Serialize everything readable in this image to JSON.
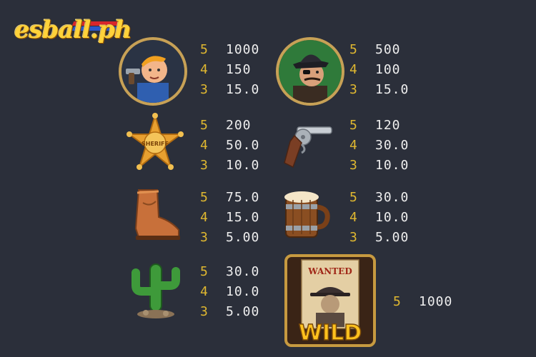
{
  "logo": {
    "text": "esball.ph"
  },
  "symbols": [
    {
      "name": "cowboy",
      "pays": [
        [
          "5",
          "1000"
        ],
        [
          "4",
          "150"
        ],
        [
          "3",
          "15.0"
        ]
      ]
    },
    {
      "name": "bandit",
      "pays": [
        [
          "5",
          "500"
        ],
        [
          "4",
          "100"
        ],
        [
          "3",
          "15.0"
        ]
      ]
    },
    {
      "name": "sheriff-badge",
      "label": "SHERIFF",
      "pays": [
        [
          "5",
          "200"
        ],
        [
          "4",
          "50.0"
        ],
        [
          "3",
          "10.0"
        ]
      ]
    },
    {
      "name": "revolver",
      "pays": [
        [
          "5",
          "120"
        ],
        [
          "4",
          "30.0"
        ],
        [
          "3",
          "10.0"
        ]
      ]
    },
    {
      "name": "boot",
      "pays": [
        [
          "5",
          "75.0"
        ],
        [
          "4",
          "15.0"
        ],
        [
          "3",
          "5.00"
        ]
      ]
    },
    {
      "name": "beer-mug",
      "pays": [
        [
          "5",
          "30.0"
        ],
        [
          "4",
          "10.0"
        ],
        [
          "3",
          "5.00"
        ]
      ]
    },
    {
      "name": "cactus",
      "pays": [
        [
          "5",
          "30.0"
        ],
        [
          "4",
          "10.0"
        ],
        [
          "3",
          "5.00"
        ]
      ]
    }
  ],
  "wild": {
    "wanted_label": "WANTED",
    "label": "WILD",
    "pays": [
      [
        "5",
        "1000"
      ]
    ]
  },
  "colors": {
    "background": "#2b2f3a",
    "count": "#e0b830",
    "value": "#eeeeee",
    "gold": "#c7a156"
  }
}
